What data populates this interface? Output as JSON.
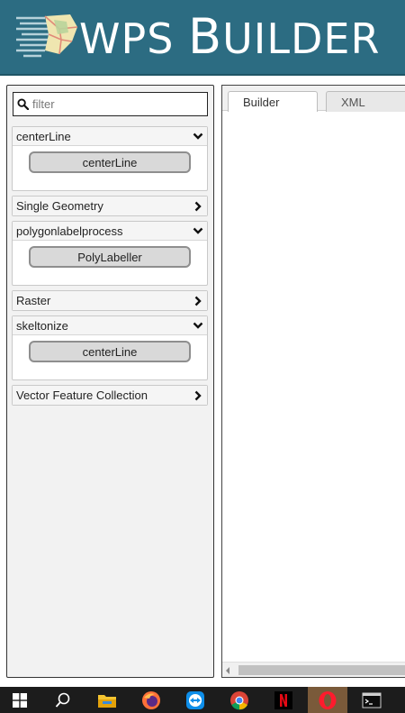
{
  "header": {
    "brand_part1": "WPS ",
    "brand_b": "B",
    "brand_part2": "UILDER"
  },
  "filter": {
    "placeholder": "filter",
    "value": ""
  },
  "groups": [
    {
      "label": "centerLine",
      "expanded": true,
      "button": "centerLine"
    },
    {
      "label": "Single Geometry",
      "expanded": false
    },
    {
      "label": "polygonlabelprocess",
      "expanded": true,
      "button": "PolyLabeller"
    },
    {
      "label": "Raster",
      "expanded": false
    },
    {
      "label": "skeltonize",
      "expanded": true,
      "button": "centerLine"
    },
    {
      "label": "Vector Feature Collection",
      "expanded": false
    }
  ],
  "tabs": [
    {
      "label": "Builder",
      "active": true
    },
    {
      "label": "XML",
      "active": false
    }
  ],
  "taskbar": {
    "items": [
      "windows-start-icon",
      "search-icon",
      "file-explorer-icon",
      "firefox-icon",
      "teamviewer-icon",
      "chrome-icon",
      "netflix-icon",
      "opera-icon",
      "terminal-icon"
    ]
  },
  "colors": {
    "header_bg": "#2c6c82",
    "panel_bg": "#f2f2f2",
    "button_bg": "#d9d9d9"
  }
}
